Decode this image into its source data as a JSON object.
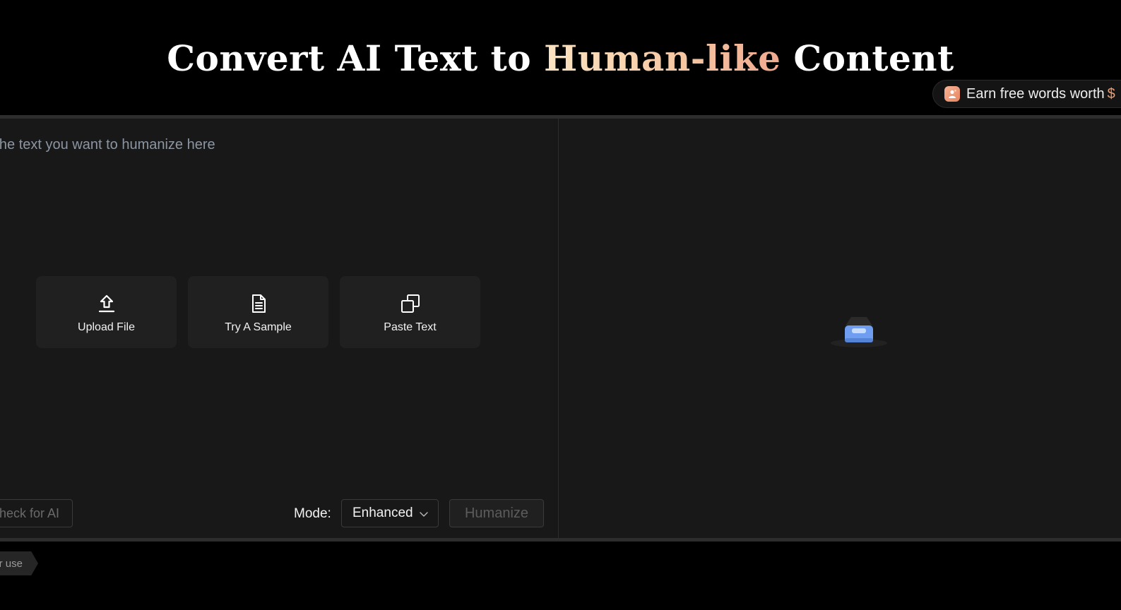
{
  "hero": {
    "title_prefix": "Convert AI Text to ",
    "title_highlight": "Human-like",
    "title_suffix": " Content"
  },
  "earn_banner": {
    "text": "Earn free words worth",
    "amount_fragment": "$",
    "icon": "gift-icon"
  },
  "editor": {
    "placeholder": "er the text you want to humanize here",
    "actions": [
      {
        "label": "Upload File",
        "icon": "upload-icon"
      },
      {
        "label": "Try A Sample",
        "icon": "document-icon"
      },
      {
        "label": "Paste Text",
        "icon": "copy-icon"
      }
    ],
    "check_ai_label": "heck for AI",
    "mode_label": "Mode:",
    "mode_value": "Enhanced",
    "humanize_label": "Humanize",
    "output_placeholder_icon": "empty-inbox-icon"
  },
  "footer": {
    "fair_use_label": "r use"
  },
  "colors": {
    "background": "#000000",
    "panel": "#181818",
    "card": "#202020",
    "highlight_gradient_start": "#fbe3c2",
    "highlight_gradient_end": "#f0a98f",
    "accent_orange": "#f29a6b",
    "illustration_blue": "#6f9df0"
  }
}
